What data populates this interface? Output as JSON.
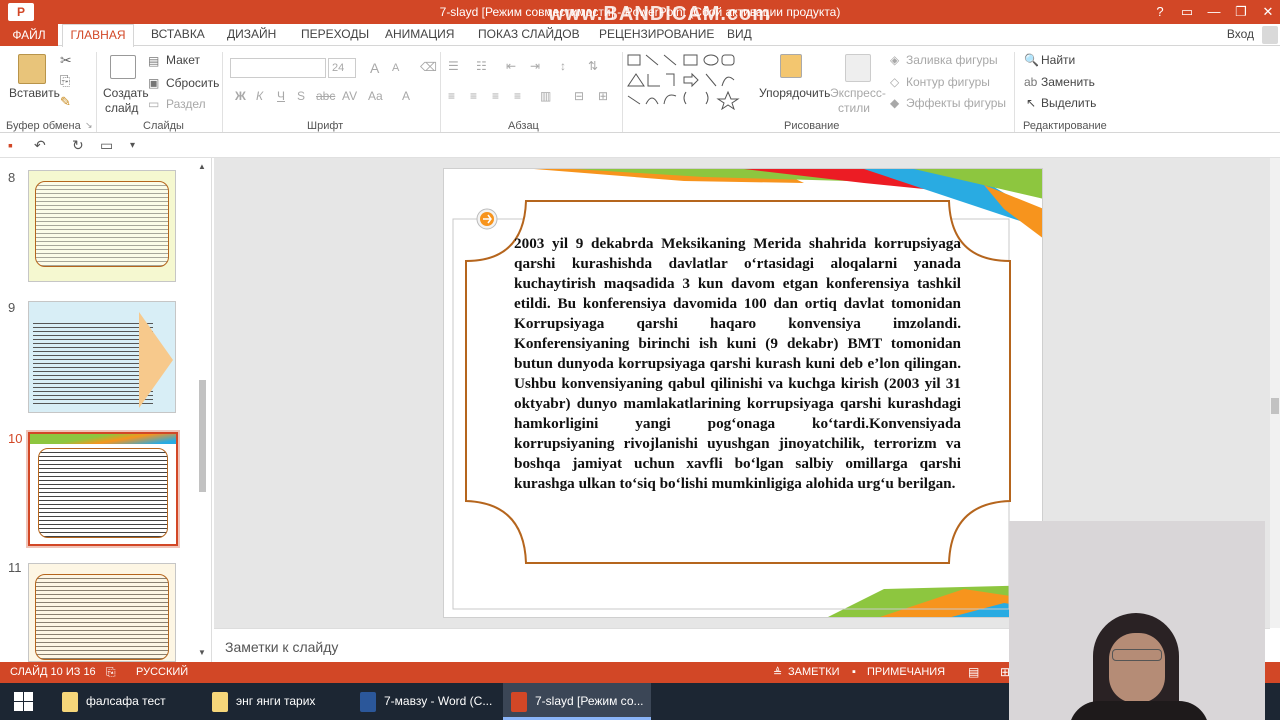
{
  "window": {
    "app_icon": "P",
    "title": "7-slayd [Режим совместимости] - PowerPoint (Сбой активации продукта)",
    "watermark": "www.BANDICAM.com",
    "buttons": [
      "?",
      "▭",
      "—",
      "❐",
      "✕"
    ]
  },
  "tabs": {
    "file": "ФАЙЛ",
    "active": "ГЛАВНАЯ",
    "items": [
      "ВСТАВКА",
      "ДИЗАЙН",
      "ПЕРЕХОДЫ",
      "АНИМАЦИЯ",
      "ПОКАЗ СЛАЙДОВ",
      "РЕЦЕНЗИРОВАНИЕ",
      "ВИД"
    ],
    "login": "Вход"
  },
  "ribbon": {
    "clipboard": {
      "paste": "Вставить",
      "label": "Буфер обмена"
    },
    "slides": {
      "new_slide_1": "Создать",
      "new_slide_2": "слайд",
      "layout": "Макет",
      "reset": "Сбросить",
      "section": "Раздел",
      "label": "Слайды"
    },
    "font": {
      "size": "24",
      "bold": "Ж",
      "italic": "К",
      "underline": "Ч",
      "strike": "abc",
      "spacing": "AV",
      "case": "Aa",
      "grow": "A",
      "shrink": "A",
      "label": "Шрифт"
    },
    "paragraph": {
      "label": "Абзац"
    },
    "drawing": {
      "arrange": "Упорядочить",
      "quick_styles_1": "Экспресс-",
      "quick_styles_2": "стили",
      "fill": "Заливка фигуры",
      "outline": "Контур фигуры",
      "effects": "Эффекты фигуры",
      "label": "Рисование"
    },
    "editing": {
      "find": "Найти",
      "replace": "Заменить",
      "select": "Выделить",
      "label": "Редактирование"
    }
  },
  "thumbnails": [
    {
      "number": "8",
      "selected": false
    },
    {
      "number": "9",
      "selected": false
    },
    {
      "number": "10",
      "selected": true
    },
    {
      "number": "11",
      "selected": false
    }
  ],
  "slide": {
    "text": "2003 yil 9 dekabrda Meksikaning Merida shahrida korrupsiyaga qarshi kurashishda davlatlar o‘rtasidagi aloqalarni yanada kuchaytirish maqsadida 3 kun davom etgan konferensiya tashkil etildi. Bu konferensiya davomida 100 dan ortiq davlat tomonidan Korrupsiyaga qarshi haqaro konvensiya imzolandi. Konferensiyaning birinchi ish kuni (9 dekabr) BMT tomonidan butun dunyoda korrupsiyaga qarshi kurash kuni deb e’lon qilingan. Ushbu konvensiyaning qabul qilinishi va kuchga kirish (2003 yil 31 oktyabr) dunyo mamlakatlarining korrupsiyaga qarshi kurashdagi hamkorligini yangi pog‘onaga ko‘tardi.Konvensiyada korrupsiyaning rivojlanishi uyushgan jinoyatchilik, terrorizm va boshqa jamiyat uchun xavfli bo‘lgan salbiy omillarga qarshi kurashga ulkan to‘siq bo‘lishi mumkinligiga alohida urg‘u berilgan.",
    "frame_color": "#b5651d",
    "accent_colors": [
      "#f7941d",
      "#8dc63f",
      "#29abe2",
      "#ec1c24"
    ]
  },
  "notes": {
    "placeholder": "Заметки к слайду"
  },
  "status": {
    "slide_info": "СЛАЙД 10 ИЗ 16",
    "language": "РУССКИЙ",
    "notes": "ЗАМЕТКИ",
    "comments": "ПРИМЕЧАНИЯ"
  },
  "taskbar": {
    "items": [
      {
        "label": "фалсафа тест",
        "icon": "folder-icon",
        "active": false
      },
      {
        "label": "энг янги тарих",
        "icon": "folder-icon",
        "active": false
      },
      {
        "label": "7-мавзу - Word (С...",
        "icon": "word-icon",
        "active": false
      },
      {
        "label": "7-slayd [Режим со...",
        "icon": "powerpoint-icon",
        "active": true
      }
    ]
  },
  "colors": {
    "accent": "#d24726",
    "taskbar": "#1c2633",
    "word": "#2b579a"
  }
}
